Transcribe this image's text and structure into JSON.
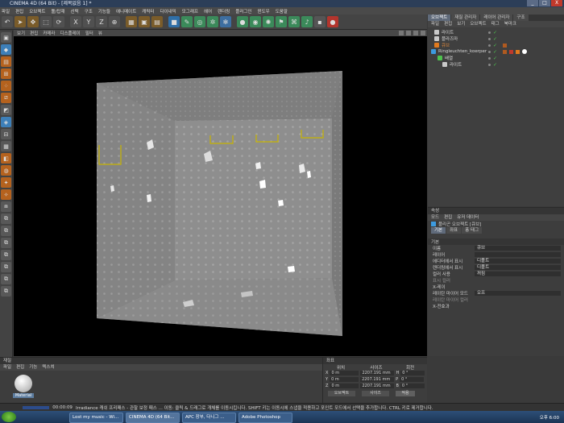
{
  "window": {
    "title": "CINEMA 4D (64 Bit) - [제목없음 1] *",
    "buttons": [
      "_",
      "□",
      "X"
    ]
  },
  "menubar": [
    "파일",
    "편집",
    "오브젝트",
    "툴/탑재",
    "선택",
    "구조",
    "기능들",
    "애니메이트",
    "캐릭터",
    "다이내믹",
    "모그래프",
    "헤어",
    "렌더링",
    "플러그인",
    "윈도우",
    "도움말"
  ],
  "toolbar": {
    "icons": [
      "undo-icon",
      "pointer-icon",
      "move-icon",
      "scale-icon",
      "rotate-icon",
      "axis-x-icon",
      "axis-y-icon",
      "axis-z-icon",
      "coord-icon",
      "render-region-icon",
      "render-view-icon",
      "render-settings-icon",
      "cube-icon",
      "spline-pen-icon",
      "subdivision-icon",
      "array-icon",
      "deformer-icon",
      "scene-icon",
      "camera-icon",
      "light-icon",
      "tag-icon",
      "python-icon",
      "sound-icon",
      "record-icon"
    ],
    "axis_labels": [
      "X",
      "Y",
      "Z"
    ]
  },
  "viewport": {
    "menu": [
      "보기",
      "편집",
      "카메라",
      "디스플레이",
      "필터",
      "뷰"
    ],
    "colors": {
      "bg": "#000000",
      "box": "#8a8a8a",
      "marker": "#c8b400"
    }
  },
  "objects": {
    "tabs": [
      "오브젝트",
      "재질 관리자",
      "레이어 관리자",
      "구조"
    ],
    "menu": [
      "파일",
      "편집",
      "보기",
      "오브젝트",
      "태그",
      "북마크"
    ],
    "rows": [
      {
        "name": "라이트",
        "indent": 0,
        "icon_color": "#c9c9c9"
      },
      {
        "name": "플라즈마",
        "indent": 0,
        "icon_color": "#c9c9c9"
      },
      {
        "name": "큐브",
        "indent": 0,
        "icon_color": "#e07a1e",
        "name_color": "#e08a3c"
      },
      {
        "name": "Ringleuchten_koerper",
        "indent": 0,
        "icon_color": "#3d9be0"
      },
      {
        "name": "배열",
        "indent": 1,
        "icon_color": "#4fc24f"
      },
      {
        "name": "라이트",
        "indent": 2,
        "icon_color": "#c9c9c9"
      }
    ]
  },
  "attributes": {
    "title": "속성",
    "menu": [
      "모드",
      "편집",
      "유저 데이터"
    ],
    "object_label": "플리곤 오브젝트 [큐브]",
    "tabs": [
      "기본",
      "좌표",
      "퐁 태그"
    ],
    "section": "기본",
    "rows": [
      {
        "label": "이름",
        "value": "큐브"
      },
      {
        "label": "레이어",
        "value": ""
      },
      {
        "label": "에디터에서 표시",
        "value": "디폴트"
      },
      {
        "label": "렌더링에서 표시",
        "value": "디폴트"
      },
      {
        "label": "컬러 사용",
        "value": "꺼짐"
      },
      {
        "label": "표시 컬러",
        "value": ""
      },
      {
        "label": "X-레이",
        "value": ""
      },
      {
        "label": "레이탄 마이어 모드",
        "value": "오프"
      },
      {
        "label": "레이탄 마이어 컬러",
        "value": ""
      },
      {
        "label": "X-전효과",
        "value": ""
      }
    ]
  },
  "material": {
    "title": "재질",
    "menu": [
      "파일",
      "편집",
      "기능",
      "텍스쳐"
    ],
    "swatch_label": "Material"
  },
  "coords": {
    "title": "좌표",
    "headers": [
      "위치",
      "사이즈",
      "회전"
    ],
    "rows": [
      {
        "axis": "X",
        "pos": "0 m",
        "size": "2207.191 mm",
        "rot_axis": "H",
        "rot": "0 °"
      },
      {
        "axis": "Y",
        "pos": "0 m",
        "size": "2207.191 mm",
        "rot_axis": "P",
        "rot": "0 °"
      },
      {
        "axis": "Z",
        "pos": "0 m",
        "size": "2207.191 mm",
        "rot_axis": "B",
        "rot": "0 °"
      }
    ],
    "dropdown1": "오브젝트",
    "dropdown2": "사이즈",
    "apply": "적용"
  },
  "status": {
    "time": "00:00:09",
    "text": "Irradiance 캐쉬 프리패스 - 관찰 보정 패스 ...  이동: 클릭 & 드래그로 개체를 이동시킵니다. SHIFT 키는 이동시에 스냅을 적용하고 포인트 모드에서 선택을 추가합니다. CTRL 키로 제거합니다."
  },
  "taskbar": {
    "items": [
      "Lost my music - Wi...",
      "CINEMA 4D (64 Bit...",
      "APC 장부, 다니그 ...",
      "Adobe Photoshop"
    ],
    "clock": "오후 6:00"
  }
}
